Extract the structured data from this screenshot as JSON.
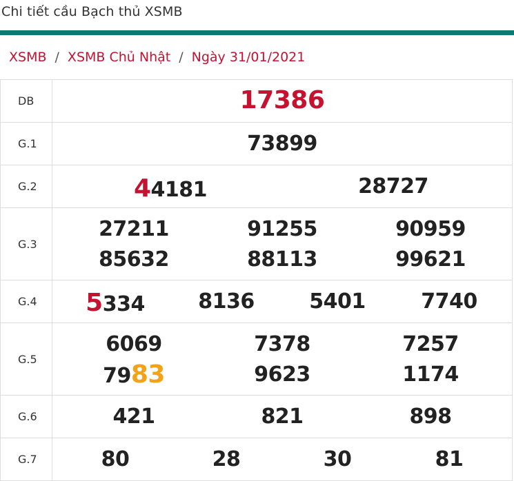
{
  "page": {
    "title": "Chi tiết cầu Bạch thủ XSMB"
  },
  "breadcrumb": {
    "items": [
      "XSMB",
      "XSMB Chủ Nhật",
      "Ngày 31/01/2021"
    ],
    "separator": "/"
  },
  "colors": {
    "accent": "#0b7a75",
    "red": "#c41230",
    "orange": "#f4a217"
  },
  "prizes": {
    "db": {
      "label": "DB",
      "numbers": [
        "17386"
      ]
    },
    "g1": {
      "label": "G.1",
      "numbers": [
        "73899"
      ]
    },
    "g2": {
      "label": "G.2",
      "numbers": [
        {
          "hl": "4",
          "rest": "4181"
        },
        "28727"
      ]
    },
    "g3": {
      "label": "G.3",
      "numbers": [
        "27211",
        "91255",
        "90959",
        "85632",
        "88113",
        "99621"
      ]
    },
    "g4": {
      "label": "G.4",
      "numbers": [
        {
          "hl": "5",
          "rest": "334"
        },
        "8136",
        "5401",
        "7740"
      ]
    },
    "g5": {
      "label": "G.5",
      "numbers": [
        "6069",
        "7378",
        "7257",
        {
          "pre": "79",
          "hl": "83"
        },
        "9623",
        "1174"
      ]
    },
    "g6": {
      "label": "G.6",
      "numbers": [
        "421",
        "821",
        "898"
      ]
    },
    "g7": {
      "label": "G.7",
      "numbers": [
        "80",
        "28",
        "30",
        "81"
      ]
    }
  }
}
